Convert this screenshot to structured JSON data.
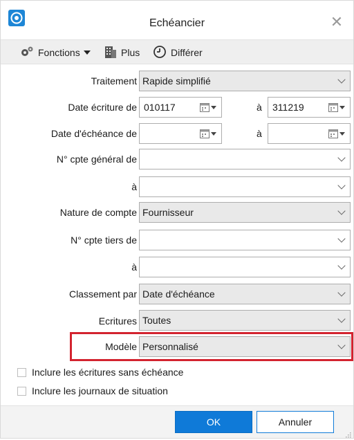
{
  "window": {
    "title": "Echéancier",
    "close_glyph": "✕"
  },
  "toolbar": {
    "fonctions_label": "Fonctions",
    "plus_label": "Plus",
    "differer_label": "Différer"
  },
  "form": {
    "traitement": {
      "label": "Traitement",
      "value": "Rapide simplifié"
    },
    "date_ecriture": {
      "label": "Date écriture de",
      "from": "010117",
      "to_label": "à",
      "to": "311219"
    },
    "date_echeance": {
      "label": "Date d'échéance de",
      "from": "",
      "to_label": "à",
      "to": ""
    },
    "cpte_general_from": {
      "label": "N° cpte général de",
      "value": ""
    },
    "cpte_general_to": {
      "label": "à",
      "value": ""
    },
    "nature_compte": {
      "label": "Nature de compte",
      "value": "Fournisseur"
    },
    "cpte_tiers_from": {
      "label": "N° cpte tiers de",
      "value": ""
    },
    "cpte_tiers_to": {
      "label": "à",
      "value": ""
    },
    "classement": {
      "label": "Classement par",
      "value": "Date d'échéance"
    },
    "ecritures": {
      "label": "Ecritures",
      "value": "Toutes"
    },
    "modele": {
      "label": "Modèle",
      "value": "Personnalisé"
    }
  },
  "checkboxes": {
    "sans_echeance": {
      "label": "Inclure les écritures sans échéance",
      "checked": false
    },
    "journaux_situation": {
      "label": "Inclure les journaux de situation",
      "checked": false
    }
  },
  "buttons": {
    "ok": "OK",
    "cancel": "Annuler"
  },
  "colors": {
    "accent": "#0f7ad8",
    "highlight": "#d3232f",
    "combo_fill": "#e9e9e9"
  },
  "icons": {
    "app": "app-logo-icon",
    "fonctions": "gears-icon",
    "plus": "building-icon",
    "differer": "clock-icon",
    "calendar": "calendar-icon",
    "dropdown": "chevron-down-icon"
  }
}
